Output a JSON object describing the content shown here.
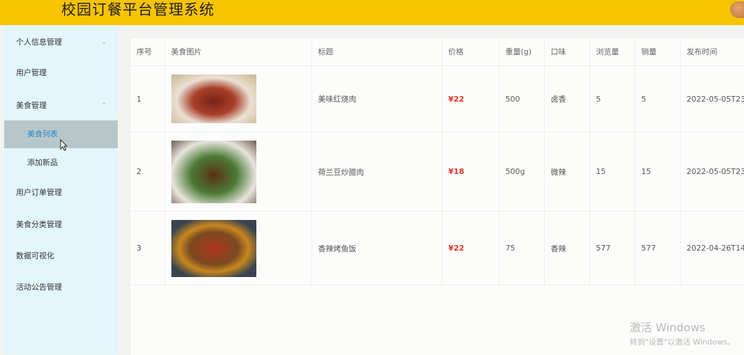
{
  "header": {
    "title": "校园订餐平台管理系统"
  },
  "sidebar": {
    "items": [
      {
        "label": "个人信息管理",
        "chevron": "chevron-down"
      },
      {
        "label": "用户管理"
      },
      {
        "label": "美食管理",
        "chevron": "chevron-up"
      },
      {
        "label": "美食列表",
        "active": true
      },
      {
        "label": "添加新品"
      },
      {
        "label": "用户订单管理"
      },
      {
        "label": "美食分类管理"
      },
      {
        "label": "数据可视化"
      },
      {
        "label": "活动公告管理"
      }
    ]
  },
  "table": {
    "headers": [
      "序号",
      "美食图片",
      "标题",
      "价格",
      "重量(g)",
      "口味",
      "浏览量",
      "销量",
      "发布时间"
    ],
    "rows": [
      {
        "index": "1",
        "title": "美味红烧肉",
        "price": "¥22",
        "weight": "500",
        "flavor": "卤香",
        "views": "5",
        "sales": "5",
        "time": "2022-05-05T23"
      },
      {
        "index": "2",
        "title": "荷兰豆炒腊肉",
        "price": "¥18",
        "weight": "500g",
        "flavor": "微辣",
        "views": "15",
        "sales": "15",
        "time": "2022-05-05T23"
      },
      {
        "index": "3",
        "title": "香辣烤鱼饭",
        "price": "¥22",
        "weight": "75",
        "flavor": "香辣",
        "views": "577",
        "sales": "577",
        "time": "2022-04-26T14"
      }
    ]
  },
  "watermark": {
    "line1": "激活 Windows",
    "line2": "转到\"设置\"以激活 Windows。"
  },
  "colors": {
    "header": "#f8c400",
    "sidebar": "#e2f6fb",
    "active_item_bg": "#b7c7c9",
    "active_item_text": "#2f86c9",
    "price": "#e13a2a"
  }
}
